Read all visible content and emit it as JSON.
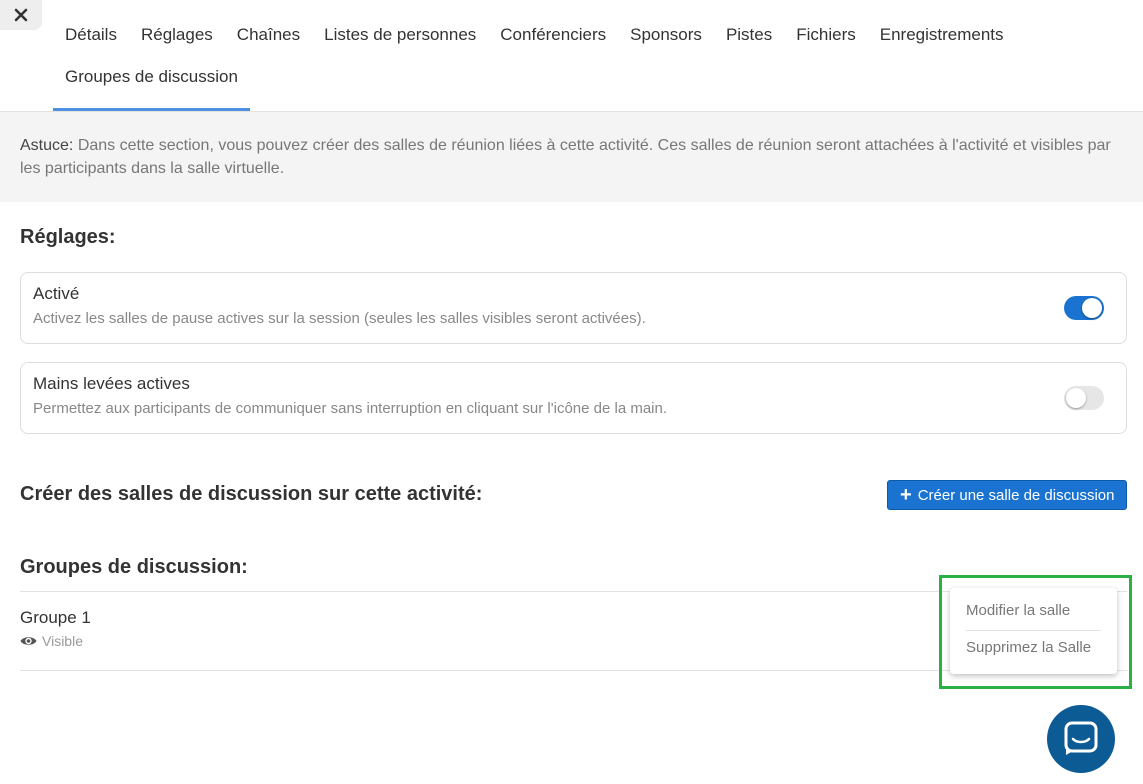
{
  "tabs": [
    {
      "label": "Détails"
    },
    {
      "label": "Réglages"
    },
    {
      "label": "Chaînes"
    },
    {
      "label": "Listes de personnes"
    },
    {
      "label": "Conférenciers"
    },
    {
      "label": "Sponsors"
    },
    {
      "label": "Pistes"
    },
    {
      "label": "Fichiers"
    },
    {
      "label": "Enregistrements"
    }
  ],
  "active_tab": {
    "label": "Groupes de discussion"
  },
  "tip": {
    "prefix": "Astuce:",
    "text": "Dans cette section, vous pouvez créer des salles de réunion liées à cette activité. Ces salles de réunion seront attachées à l'activité et visibles par les participants dans la salle virtuelle."
  },
  "settings": {
    "title": "Réglages:",
    "items": [
      {
        "title": "Activé",
        "description": "Activez les salles de pause actives sur la session (seules les salles visibles seront activées).",
        "enabled": true
      },
      {
        "title": "Mains levées actives",
        "description": "Permettez aux participants de communiquer sans interruption en cliquant sur l'icône de la main.",
        "enabled": false
      }
    ]
  },
  "create": {
    "title": "Créer des salles de discussion sur cette activité:",
    "button_label": "Créer une salle de discussion"
  },
  "groups": {
    "title": "Groupes de discussion:",
    "items": [
      {
        "name": "Groupe 1",
        "visibility": "Visible"
      }
    ]
  },
  "context_menu": {
    "items": [
      "Modifier la salle",
      "Supprimez la Salle"
    ]
  },
  "colors": {
    "accent": "#1a73d0",
    "tab_indicator": "#4f8fe0",
    "highlight": "#2bb044",
    "chat": "#0d5b95"
  },
  "icons": [
    "close-icon",
    "plus-icon",
    "eye-icon",
    "chat-icon"
  ]
}
